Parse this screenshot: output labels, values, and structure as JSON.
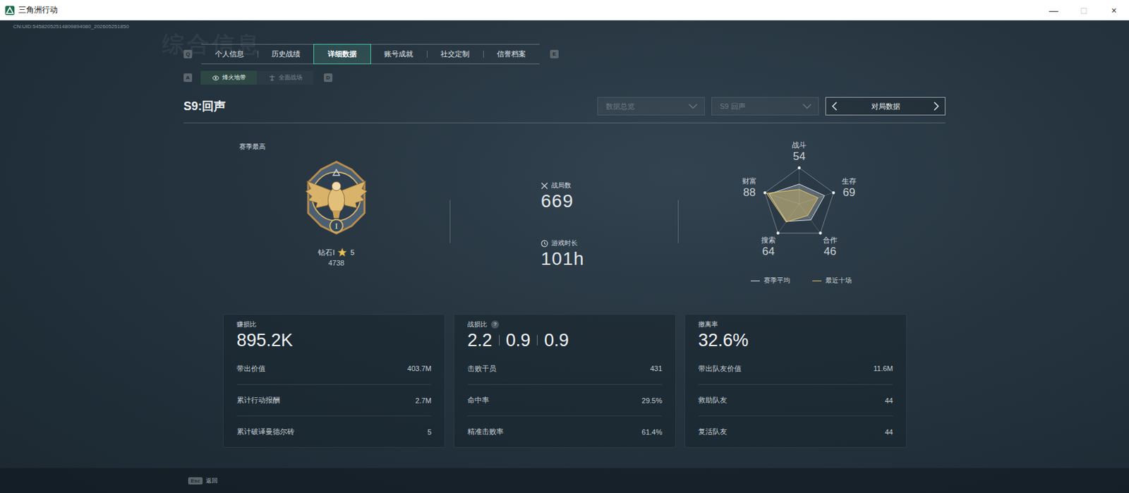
{
  "window": {
    "title": "三角洲行动",
    "controls": [
      {
        "glyph": "—",
        "disabled": false
      },
      {
        "glyph": "□",
        "disabled": true
      },
      {
        "glyph": "×",
        "disabled": false
      }
    ]
  },
  "uid": "CN:UID:54582052514809894080_202605251850",
  "watermark": "综合信息",
  "tabs": {
    "prev_key": "Q",
    "next_key": "E",
    "items": [
      {
        "label": "个人信息",
        "selected": false
      },
      {
        "label": "历史战绩",
        "selected": false
      },
      {
        "label": "详细数据",
        "selected": true
      },
      {
        "label": "账号成就",
        "selected": false
      },
      {
        "label": "社交定制",
        "selected": false
      },
      {
        "label": "信誉档案",
        "selected": false
      }
    ]
  },
  "sub_tabs": {
    "prev_key": "A",
    "next_key": "D",
    "items": [
      {
        "label": "烽火地带",
        "selected": true
      },
      {
        "label": "全面战场",
        "selected": false
      }
    ]
  },
  "season_title": "S9:回声",
  "filters": [
    {
      "label": "数据总览"
    },
    {
      "label": "S9 回声"
    }
  ],
  "pager": {
    "label": "对局数据"
  },
  "rank": {
    "label": "赛季最高",
    "name": "钻石I",
    "star_count": "5",
    "score": "4738",
    "tier_numeral": "I"
  },
  "overview": [
    {
      "label": "战局数",
      "value": "669"
    },
    {
      "label": "游戏时长",
      "value": "101h"
    }
  ],
  "radar": {
    "axes": [
      {
        "label": "战斗",
        "value": "54"
      },
      {
        "label": "生存",
        "value": "69"
      },
      {
        "label": "合作",
        "value": "46"
      },
      {
        "label": "搜索",
        "value": "64"
      },
      {
        "label": "财富",
        "value": "88"
      }
    ],
    "series": [
      {
        "name": "赛季平均",
        "color": "#d9dee2",
        "values": [
          55,
          74,
          55,
          60,
          88
        ]
      },
      {
        "name": "最近十场",
        "color": "#e3c466",
        "values": [
          40,
          55,
          40,
          62,
          95
        ]
      }
    ]
  },
  "cards": [
    {
      "title": "赚损比",
      "values": [
        "895.2K"
      ],
      "rows": [
        {
          "label": "带出价值",
          "value": "403.7M"
        },
        {
          "label": "累计行动报酬",
          "value": "2.7M"
        },
        {
          "label": "累计破译曼德尔砖",
          "value": "5"
        }
      ]
    },
    {
      "title": "战损比",
      "help": "?",
      "values": [
        "2.2",
        "0.9",
        "0.9"
      ],
      "rows": [
        {
          "label": "击败干员",
          "value": "431"
        },
        {
          "label": "命中率",
          "value": "29.5%"
        },
        {
          "label": "精准击败率",
          "value": "61.4%"
        }
      ]
    },
    {
      "title": "撤离率",
      "values": [
        "32.6%"
      ],
      "rows": [
        {
          "label": "带出队友价值",
          "value": "11.6M"
        },
        {
          "label": "救助队友",
          "value": "44"
        },
        {
          "label": "复活队友",
          "value": "44"
        }
      ]
    }
  ],
  "footer": {
    "key": "Esc",
    "label": "返回"
  }
}
